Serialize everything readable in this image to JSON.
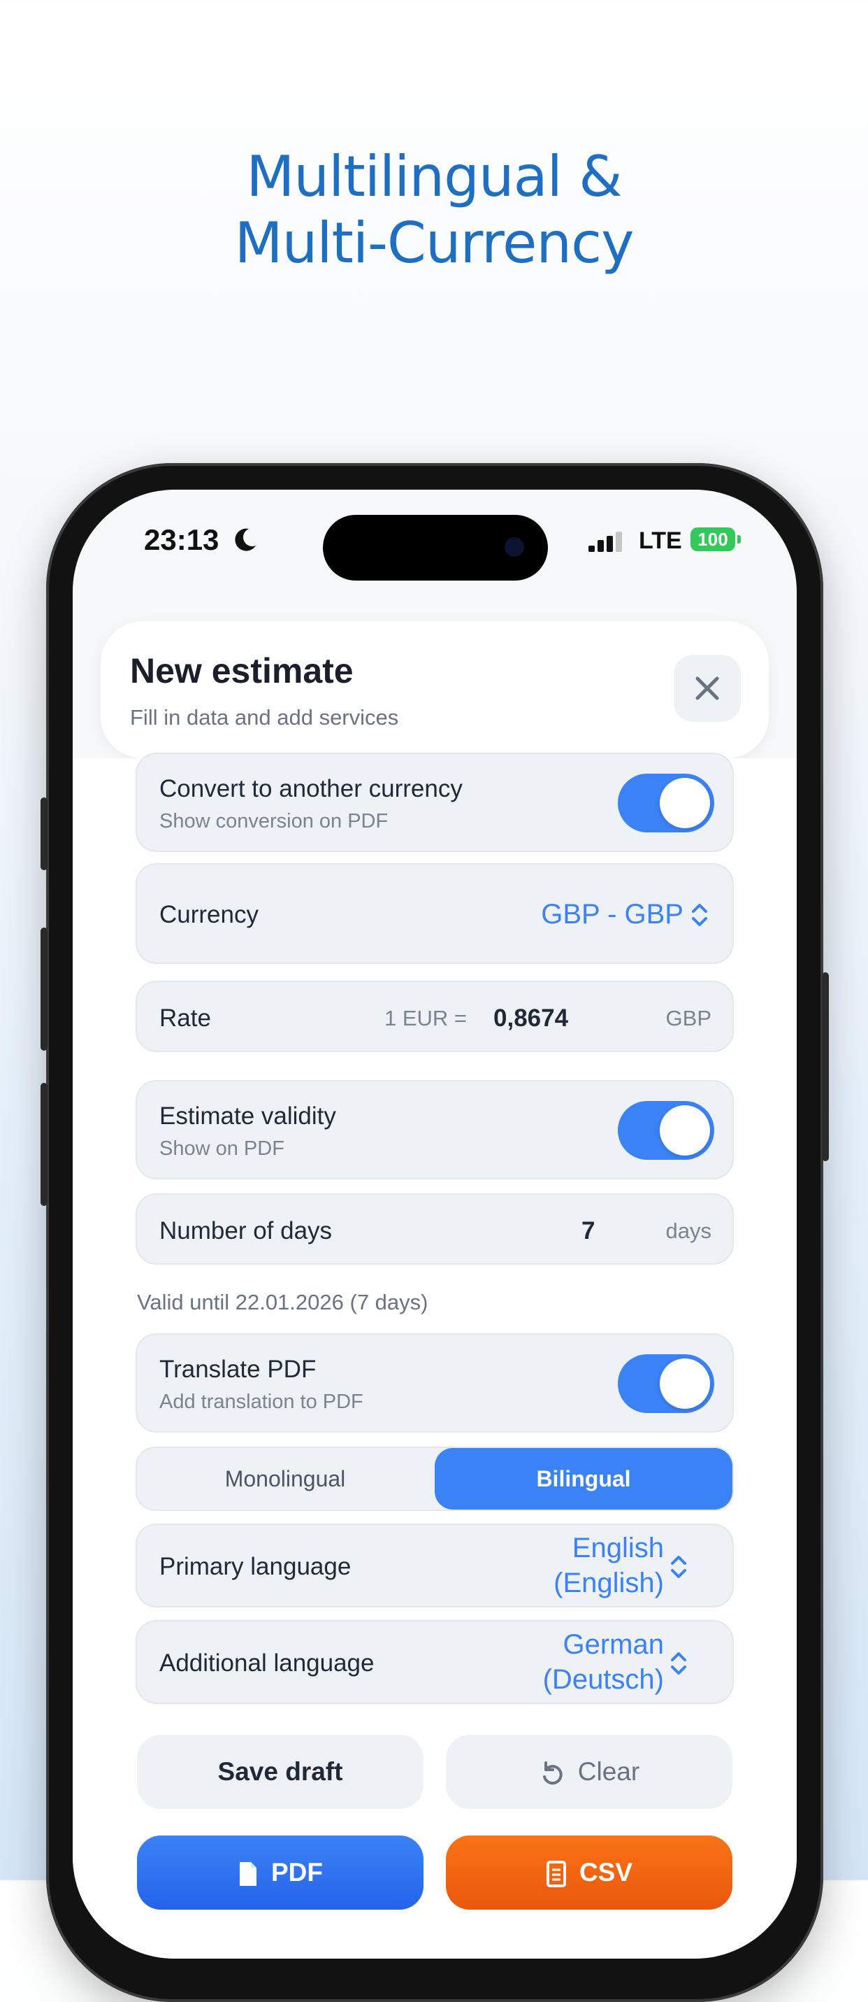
{
  "headline": {
    "line1": "Multilingual &",
    "line2": "Multi-Currency"
  },
  "status_bar": {
    "time": "23:13",
    "network": "LTE",
    "battery": "100"
  },
  "modal": {
    "title": "New estimate",
    "subtitle": "Fill in data and add services"
  },
  "currency_conversion": {
    "title": "Convert to another currency",
    "subtitle": "Show conversion on PDF",
    "enabled": true
  },
  "currency": {
    "label": "Currency",
    "value": "GBP - GBP"
  },
  "rate": {
    "label": "Rate",
    "prefix": "1 EUR =",
    "value": "0,8674",
    "unit": "GBP"
  },
  "validity": {
    "title": "Estimate validity",
    "subtitle": "Show on PDF",
    "enabled": true
  },
  "days": {
    "label": "Number of days",
    "value": "7",
    "unit": "days"
  },
  "valid_until": "Valid until 22.01.2026 (7 days)",
  "translate": {
    "title": "Translate PDF",
    "subtitle": "Add translation to PDF",
    "enabled": true
  },
  "mode": {
    "options": [
      "Monolingual",
      "Bilingual"
    ],
    "selected": "Bilingual"
  },
  "primary_language": {
    "label": "Primary language",
    "value_line1": "English",
    "value_line2": "(English)"
  },
  "additional_language": {
    "label": "Additional language",
    "value_line1": "German",
    "value_line2": "(Deutsch)"
  },
  "actions": {
    "save_draft": "Save draft",
    "clear": "Clear",
    "pdf": "PDF",
    "csv": "CSV"
  },
  "colors": {
    "accent": "#3b82f6",
    "headline": "#1e6fc2",
    "csv": "#f97316"
  }
}
